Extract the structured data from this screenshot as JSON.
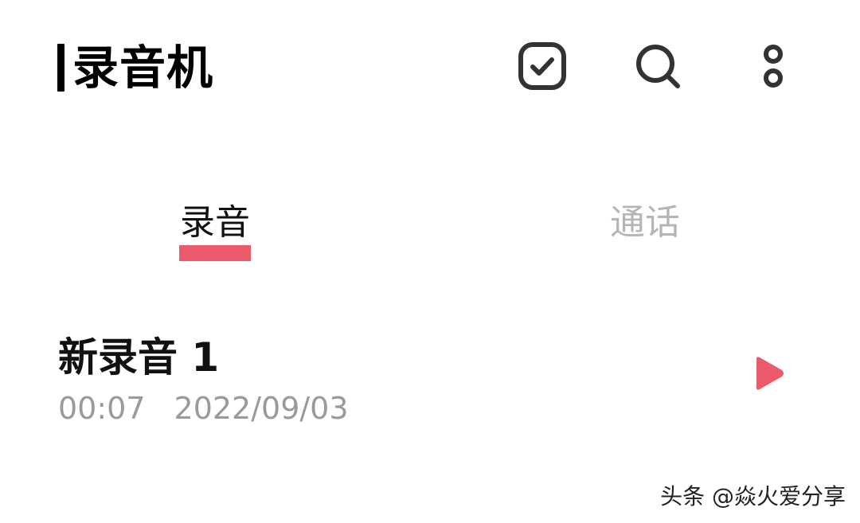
{
  "header": {
    "title": "录音机",
    "icons": [
      "checkbox-select-icon",
      "search-icon",
      "more-options-icon"
    ]
  },
  "tabs": [
    {
      "label": "录音",
      "selected": true
    },
    {
      "label": "通话",
      "selected": false
    }
  ],
  "recordings": [
    {
      "name": "新录音 1",
      "duration": "00:07",
      "date": "2022/09/03"
    }
  ],
  "watermark": "头条 @焱火爱分享",
  "colors": {
    "accent": "#ea5a6a",
    "text_primary": "#111111",
    "text_secondary": "#9a9a9a",
    "tab_inactive": "#b5b5b5",
    "icon": "#333333"
  }
}
